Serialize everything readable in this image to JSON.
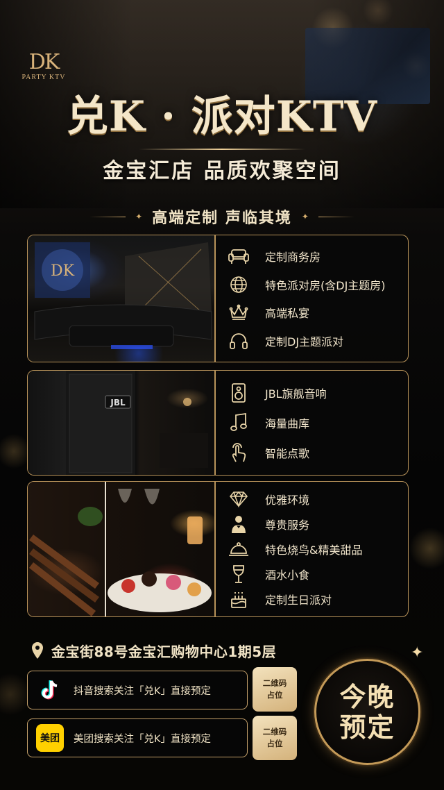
{
  "brand": {
    "mark": "DK",
    "sub": "PARTY KTV"
  },
  "title": "兑K · 派对KTV",
  "subtitle": "金宝汇店 品质欢聚空间",
  "section_title": "高端定制 声临其境",
  "panels": [
    {
      "photo": "luxury-ktv-room-photo",
      "features": [
        {
          "icon": "sofa-icon",
          "label": "定制商务房"
        },
        {
          "icon": "globe-icon",
          "label": "特色派对房(含DJ主题房)"
        },
        {
          "icon": "crown-icon",
          "label": "高端私宴"
        },
        {
          "icon": "headphones-icon",
          "label": "定制DJ主题派对"
        }
      ]
    },
    {
      "photo": "jbl-speaker-photo",
      "speaker_logo": "JBL",
      "features": [
        {
          "icon": "speaker-icon",
          "label": "JBL旗舰音响"
        },
        {
          "icon": "music-note-icon",
          "label": "海量曲库"
        },
        {
          "icon": "touch-hand-icon",
          "label": "智能点歌"
        }
      ]
    },
    {
      "photo": "food-and-drinks-photo",
      "features": [
        {
          "icon": "diamond-icon",
          "label": "优雅环境"
        },
        {
          "icon": "butler-icon",
          "label": "尊贵服务"
        },
        {
          "icon": "cloche-icon",
          "label": "特色烧鸟&精美甜品"
        },
        {
          "icon": "wine-glass-icon",
          "label": "酒水小食"
        },
        {
          "icon": "birthday-cake-icon",
          "label": "定制生日派对"
        }
      ]
    }
  ],
  "address": "金宝街88号金宝汇购物中心1期5层",
  "cta": [
    {
      "app": "douyin",
      "icon": "tiktok-icon",
      "text": "抖音搜索关注「兑K」直接预定"
    },
    {
      "app": "meituan",
      "icon": "meituan-icon",
      "logo_text": "美团",
      "text": "美团搜索关注「兑K」直接预定"
    }
  ],
  "qr": [
    {
      "line1": "二维码",
      "line2": "占位"
    },
    {
      "line1": "二维码",
      "line2": "占位"
    }
  ],
  "booking": {
    "line1": "今晚",
    "line2": "预定"
  },
  "colors": {
    "gold": "#b8935a",
    "cream": "#f1e4c6",
    "background": "#050505",
    "meituan_yellow": "#ffd000"
  }
}
